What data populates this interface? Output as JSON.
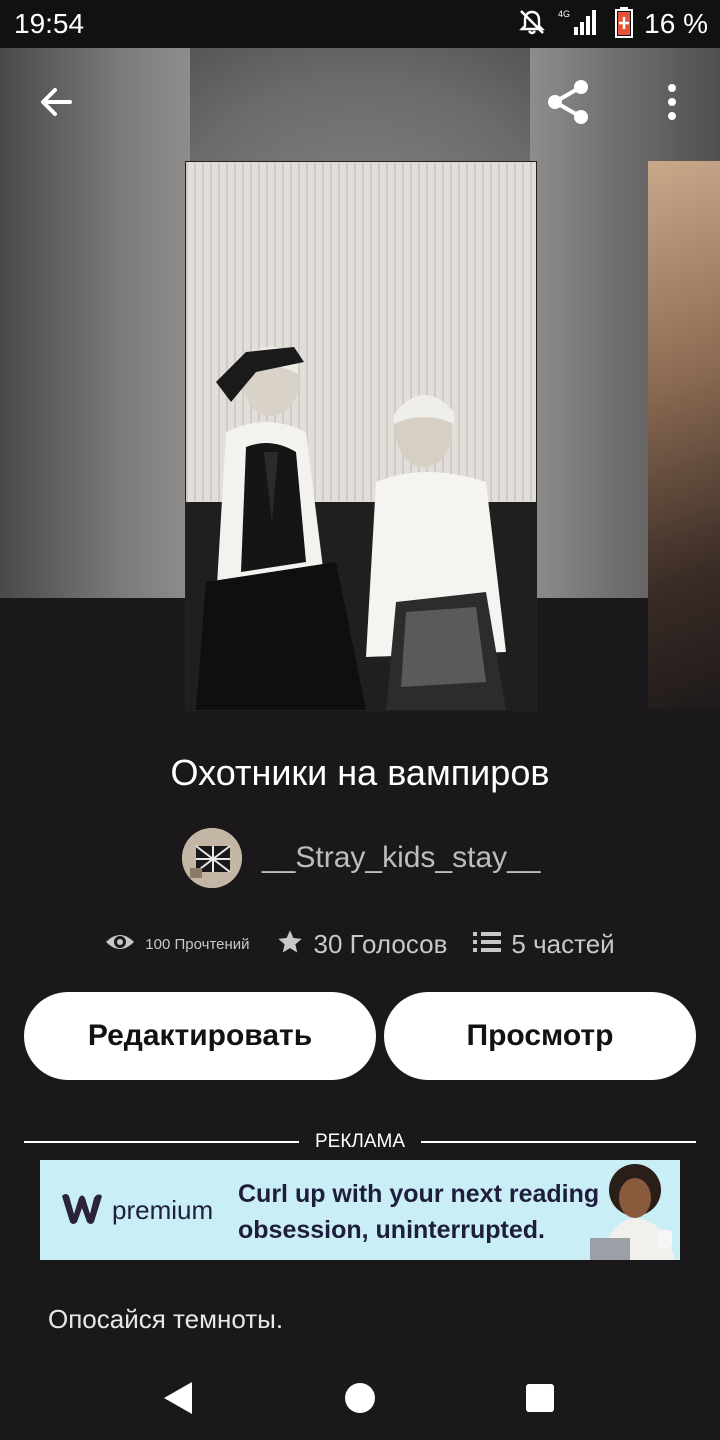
{
  "status_bar": {
    "time": "19:54",
    "network": "4G",
    "battery": "16 %",
    "icons": [
      "mute-icon",
      "signal-icon",
      "battery-low-icon"
    ]
  },
  "toolbar": {
    "back_icon": "arrow-left-icon",
    "share_icon": "share-icon",
    "more_icon": "more-vert-icon"
  },
  "story": {
    "title": "Охотники на вампиров",
    "author": "__Stray_kids_stay__",
    "reads": "100 Прочтений",
    "votes": "30 Голосов",
    "parts": "5 частей",
    "description": "Опосайся темноты."
  },
  "actions": {
    "edit_label": "Редактировать",
    "preview_label": "Просмотр"
  },
  "ad": {
    "label": "РЕКЛАМА",
    "brand_text": "premium",
    "brand_letter": "w",
    "copy_line1": "Curl up with your next reading",
    "copy_line2": "obsession, uninterrupted."
  },
  "colors": {
    "background": "#1b181c",
    "button_bg": "#ffffff",
    "ad_bg": "#c9eef5"
  }
}
